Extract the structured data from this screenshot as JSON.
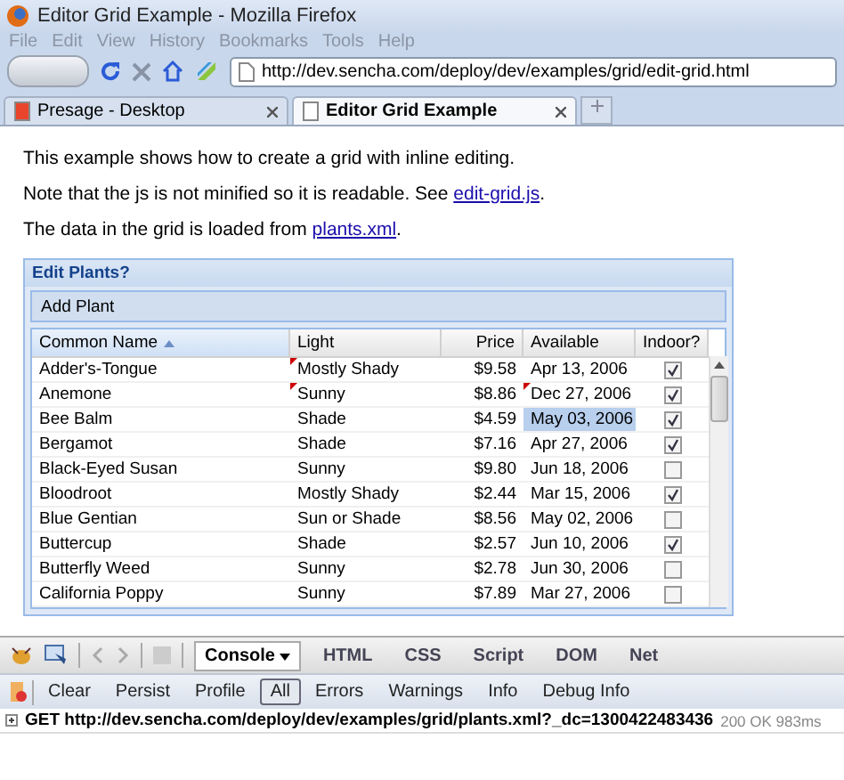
{
  "window": {
    "title": "Editor Grid Example - Mozilla Firefox"
  },
  "menu": [
    "File",
    "Edit",
    "View",
    "History",
    "Bookmarks",
    "Tools",
    "Help"
  ],
  "address_bar": {
    "value": "http://dev.sencha.com/deploy/dev/examples/grid/edit-grid.html"
  },
  "tabs": [
    {
      "label": "Presage - Desktop",
      "selected": false
    },
    {
      "label": "Editor Grid Example",
      "selected": true
    }
  ],
  "page": {
    "paragraphs": [
      {
        "text": "This example shows how to create a grid with inline editing."
      },
      {
        "text": "Note that the js is not minified so it is readable. See ",
        "link": "edit-grid.js",
        "after": "."
      },
      {
        "text": "The data in the grid is loaded from ",
        "link": "plants.xml",
        "after": "."
      }
    ]
  },
  "grid": {
    "title": "Edit Plants?",
    "toolbar_button": "Add Plant",
    "columns": [
      {
        "label": "Common Name",
        "sorted": true
      },
      {
        "label": "Light",
        "sorted": false
      },
      {
        "label": "Price",
        "sorted": false
      },
      {
        "label": "Available",
        "sorted": false
      },
      {
        "label": "Indoor?",
        "sorted": false
      }
    ],
    "rows": [
      {
        "name": "Adder's-Tongue",
        "light": "Mostly Shady",
        "price": "$9.58",
        "available": "Apr 13, 2006",
        "indoor": true,
        "light_modified": true,
        "available_modified": false,
        "available_selected": false
      },
      {
        "name": "Anemone",
        "light": "Sunny",
        "price": "$8.86",
        "available": "Dec 27, 2006",
        "indoor": true,
        "light_modified": true,
        "available_modified": true,
        "available_selected": false
      },
      {
        "name": "Bee Balm",
        "light": "Shade",
        "price": "$4.59",
        "available": "May 03, 2006",
        "indoor": true,
        "light_modified": false,
        "available_modified": false,
        "available_selected": true
      },
      {
        "name": "Bergamot",
        "light": "Shade",
        "price": "$7.16",
        "available": "Apr 27, 2006",
        "indoor": true,
        "light_modified": false,
        "available_modified": false,
        "available_selected": false
      },
      {
        "name": "Black-Eyed Susan",
        "light": "Sunny",
        "price": "$9.80",
        "available": "Jun 18, 2006",
        "indoor": false,
        "light_modified": false,
        "available_modified": false,
        "available_selected": false
      },
      {
        "name": "Bloodroot",
        "light": "Mostly Shady",
        "price": "$2.44",
        "available": "Mar 15, 2006",
        "indoor": true,
        "light_modified": false,
        "available_modified": false,
        "available_selected": false
      },
      {
        "name": "Blue Gentian",
        "light": "Sun or Shade",
        "price": "$8.56",
        "available": "May 02, 2006",
        "indoor": false,
        "light_modified": false,
        "available_modified": false,
        "available_selected": false
      },
      {
        "name": "Buttercup",
        "light": "Shade",
        "price": "$2.57",
        "available": "Jun 10, 2006",
        "indoor": true,
        "light_modified": false,
        "available_modified": false,
        "available_selected": false
      },
      {
        "name": "Butterfly Weed",
        "light": "Sunny",
        "price": "$2.78",
        "available": "Jun 30, 2006",
        "indoor": false,
        "light_modified": false,
        "available_modified": false,
        "available_selected": false
      },
      {
        "name": "California Poppy",
        "light": "Sunny",
        "price": "$7.89",
        "available": "Mar 27, 2006",
        "indoor": false,
        "light_modified": false,
        "available_modified": false,
        "available_selected": false
      }
    ]
  },
  "firebug": {
    "tabs": [
      {
        "label": "Console",
        "selected": true
      },
      {
        "label": "HTML",
        "selected": false
      },
      {
        "label": "CSS",
        "selected": false
      },
      {
        "label": "Script",
        "selected": false
      },
      {
        "label": "DOM",
        "selected": false
      },
      {
        "label": "Net",
        "selected": false
      }
    ],
    "console_buttons": [
      {
        "label": "Clear",
        "selected": false
      },
      {
        "label": "Persist",
        "selected": false
      },
      {
        "label": "Profile",
        "selected": false
      },
      {
        "label": "All",
        "selected": true
      },
      {
        "label": "Errors",
        "selected": false
      },
      {
        "label": "Warnings",
        "selected": false
      },
      {
        "label": "Info",
        "selected": false
      },
      {
        "label": "Debug Info",
        "selected": false
      }
    ],
    "log": [
      {
        "request": "GET http://dev.sencha.com/deploy/dev/examples/grid/plants.xml?_dc=1300422483436",
        "status": "200 OK 983ms"
      }
    ]
  }
}
